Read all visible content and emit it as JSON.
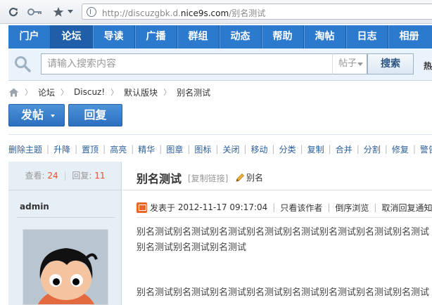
{
  "browser": {
    "url_prefix": "http://discuzgbk.d.",
    "url_domain": "nice9s.com",
    "url_suffix": "/别名测试"
  },
  "nav": {
    "items": [
      {
        "label": "门户"
      },
      {
        "label": "论坛",
        "active": true
      },
      {
        "label": "导读"
      },
      {
        "label": "广播"
      },
      {
        "label": "群组"
      },
      {
        "label": "动态"
      },
      {
        "label": "帮助"
      },
      {
        "label": "淘帖"
      },
      {
        "label": "日志"
      },
      {
        "label": "相册"
      }
    ]
  },
  "search": {
    "placeholder": "请输入搜索内容",
    "type": "帖子",
    "button": "搜索",
    "hot_label": "热搜"
  },
  "breadcrumb": {
    "items": [
      "论坛",
      "Discuz!",
      "默认版块",
      "别名测试"
    ]
  },
  "actions": {
    "post": "发帖",
    "reply": "回复"
  },
  "modbar": {
    "items": [
      "删除主题",
      "升降",
      "置顶",
      "高亮",
      "精华",
      "图章",
      "图标",
      "关闭",
      "移动",
      "分类",
      "复制",
      "合并",
      "分割",
      "修复",
      "警告"
    ]
  },
  "stats": {
    "views_label": "查看:",
    "views": "24",
    "replies_label": "回复:",
    "replies": "11"
  },
  "thread": {
    "title": "别名测试",
    "copy_link": "[复制链接]",
    "alias": "别名"
  },
  "post": {
    "author": "admin",
    "posted_label": "发表于",
    "date": "2012-11-17 09:17:04",
    "only_author": "只看该作者",
    "reverse": "倒序浏览",
    "cancel_notify": "取消回复通知",
    "para1": "别名测试别名测试别名测试别名测试别名测试别名测试别名测试别名测试别名测试别名测试别名测试",
    "para2": "别名测试别名测试别名测试别名测试别名测试别名测试别名测试别名测试"
  },
  "colors": {
    "nav_bg": "#2b7acd",
    "nav_active": "#1f5ea8",
    "button_blue": "#2b6fbf",
    "link": "#2b5e99",
    "count_orange": "#e8502a"
  }
}
